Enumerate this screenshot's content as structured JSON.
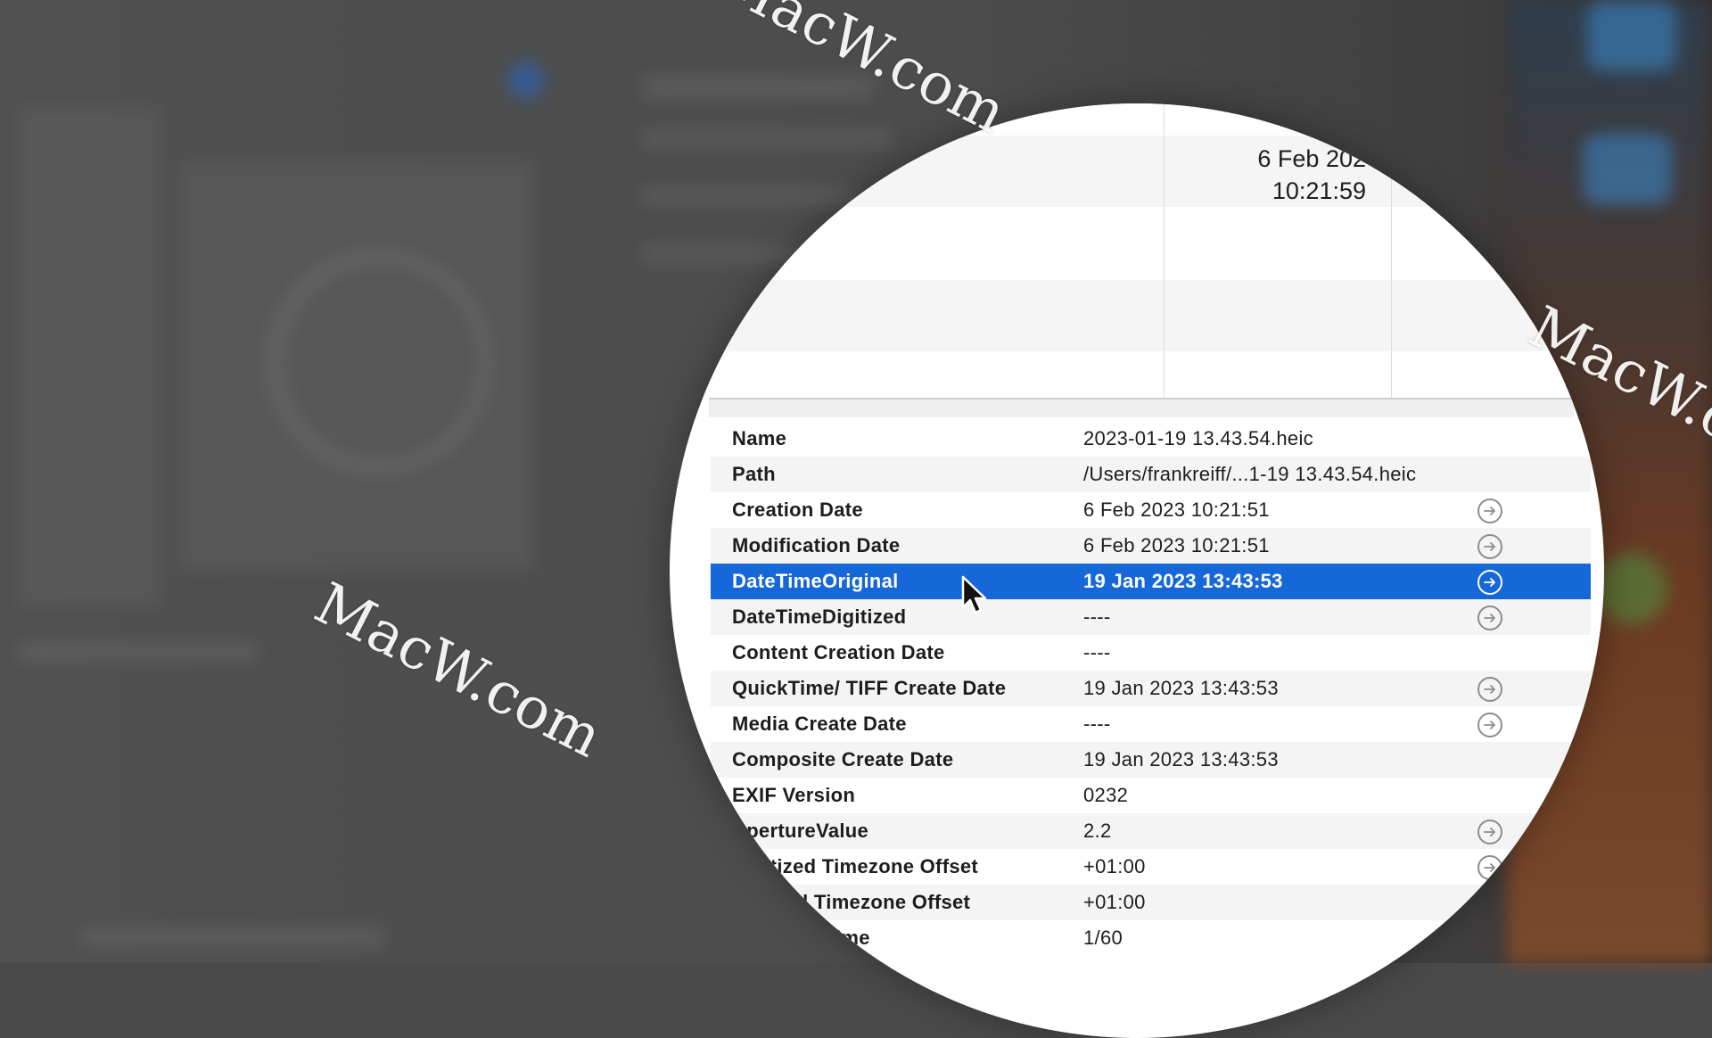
{
  "watermark": "MacW.com",
  "preview": {
    "date_line1": "6 Feb 202",
    "date_line2": "10:21:59"
  },
  "colors": {
    "selection": "#1668d8",
    "row_alt": "#f4f4f4"
  },
  "info_rows": [
    {
      "label": "Name",
      "value": "2023-01-19 13.43.54.heic",
      "has_action": false
    },
    {
      "label": "Path",
      "value": "/Users/frankreiff/...1-19 13.43.54.heic",
      "has_action": false
    },
    {
      "label": "Creation Date",
      "value": "6 Feb 2023 10:21:51",
      "has_action": true
    },
    {
      "label": "Modification Date",
      "value": "6 Feb 2023 10:21:51",
      "has_action": true
    },
    {
      "label": "DateTimeOriginal",
      "value": "19 Jan 2023 13:43:53",
      "has_action": true,
      "selected": true
    },
    {
      "label": "DateTimeDigitized",
      "value": "----",
      "has_action": true
    },
    {
      "label": "Content Creation Date",
      "value": "----",
      "has_action": false
    },
    {
      "label": "QuickTime/ TIFF Create Date",
      "value": "19 Jan 2023 13:43:53",
      "has_action": true
    },
    {
      "label": "Media Create Date",
      "value": "----",
      "has_action": true
    },
    {
      "label": "Composite Create Date",
      "value": "19 Jan 2023 13:43:53",
      "has_action": false
    },
    {
      "label": "EXIF Version",
      "value": "0232",
      "has_action": false
    },
    {
      "label": "ApertureValue",
      "value": "2.2",
      "has_action": true
    },
    {
      "label": "Digitized Timezone Offset",
      "value": "+01:00",
      "has_action": true
    },
    {
      "label": "Original Timezone Offset",
      "value": "+01:00",
      "has_action": false
    },
    {
      "label": "ExposureTime",
      "value": "1/60",
      "has_action": false
    }
  ],
  "icons": {
    "row_action": "arrow-circle-right-icon",
    "cursor": "mouse-pointer-icon"
  }
}
